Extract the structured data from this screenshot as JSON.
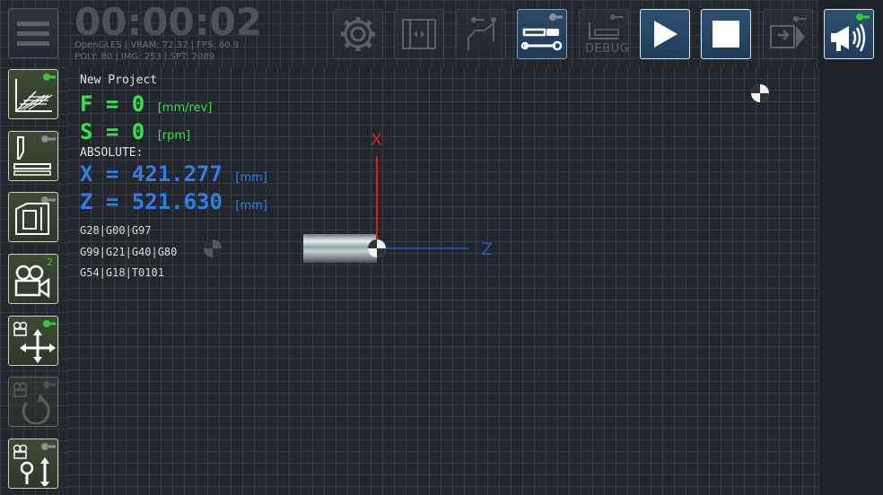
{
  "timer": "00:00:02",
  "stats": {
    "line1": "OpenGLES | VRAM: 72.32 | FPS: 60.9",
    "line2": "POLY: 80 | IMG: 253 | SPT: 2089"
  },
  "toolbar": {
    "debug_label": "DEBUG"
  },
  "left": {
    "camera_count": "2"
  },
  "info": {
    "project": "New Project",
    "feed_label": "F  =  0",
    "feed_unit": "[mm/rev]",
    "speed_label": "S  =  0",
    "speed_unit": "[rpm]",
    "mode": "ABSOLUTE:",
    "x_label": "X  =  421.277",
    "x_unit": "[mm]",
    "z_label": "Z  =  521.630",
    "z_unit": "[mm]",
    "gcodes": [
      "G28|G00|G97",
      "G99|G21|G40|G80",
      "G54|G18|T0101"
    ]
  },
  "axes": {
    "x_label": "X",
    "z_label": "Z",
    "x_color": "#d42020",
    "z_color": "#1f57d6"
  },
  "colors": {
    "feed_speed": "#2ee84a",
    "coordinates": "#2f7fe8"
  }
}
